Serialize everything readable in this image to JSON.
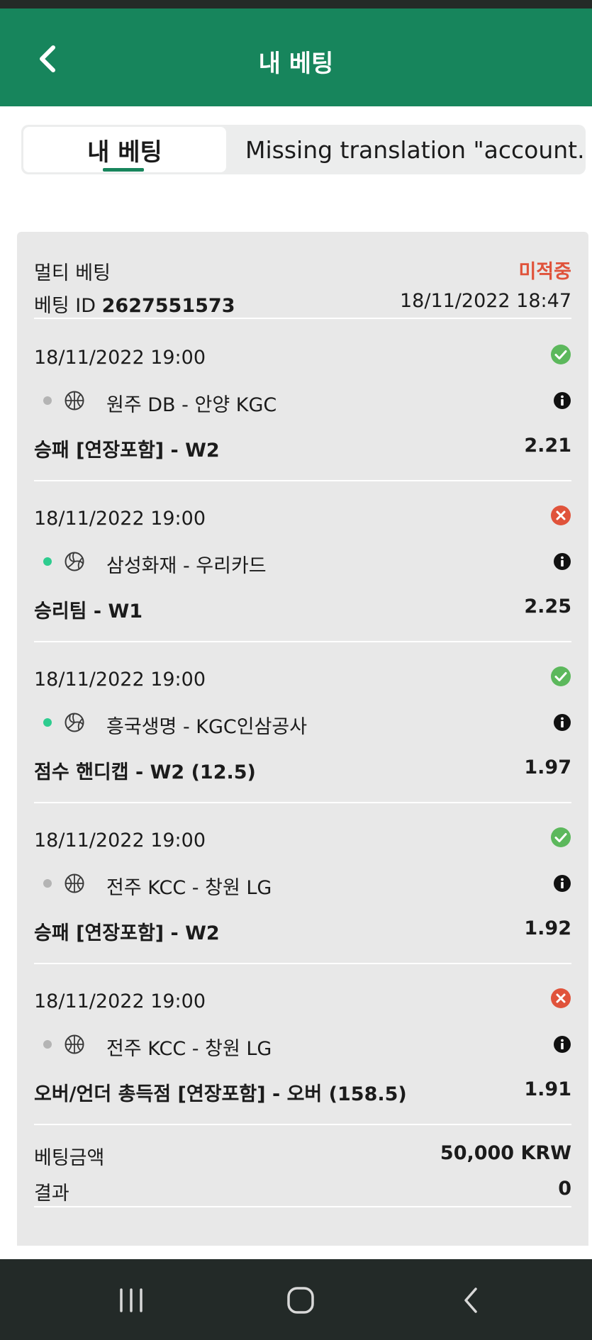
{
  "header": {
    "title": "내 베팅",
    "back_icon": "chevron-left-icon"
  },
  "tabs": [
    {
      "label": "내 베팅",
      "active": true
    },
    {
      "label": "Missing translation \"account.be",
      "active": false
    }
  ],
  "bet": {
    "type": "멀티 베팅",
    "status": "미적중",
    "id_label": "베팅 ID",
    "id_value": "2627551573",
    "datetime": "18/11/2022 18:47",
    "events": [
      {
        "date": "18/11/2022 19:00",
        "result": "won",
        "live_dot": false,
        "sport": "basketball-icon",
        "teams": "원주 DB - 안양 KGC",
        "market": "승패 [연장포함] - W2",
        "odds": "2.21"
      },
      {
        "date": "18/11/2022 19:00",
        "result": "lost",
        "live_dot": true,
        "sport": "volleyball-icon",
        "teams": "삼성화재 - 우리카드",
        "market": "승리팀 - W1",
        "odds": "2.25"
      },
      {
        "date": "18/11/2022 19:00",
        "result": "won",
        "live_dot": true,
        "sport": "volleyball-icon",
        "teams": "흥국생명 - KGC인삼공사",
        "market": "점수 핸디캡 - W2 (12.5)",
        "odds": "1.97"
      },
      {
        "date": "18/11/2022 19:00",
        "result": "won",
        "live_dot": false,
        "sport": "basketball-icon",
        "teams": "전주 KCC - 창원 LG",
        "market": "승패 [연장포함] - W2",
        "odds": "1.92"
      },
      {
        "date": "18/11/2022 19:00",
        "result": "lost",
        "live_dot": false,
        "sport": "basketball-icon",
        "teams": "전주 KCC - 창원 LG",
        "market": "오버/언더 총득점 [연장포함] - 오버 (158.5)",
        "odds": "1.91"
      }
    ],
    "stake_label": "베팅금액",
    "stake_value": "50,000 KRW",
    "result_label": "결과",
    "result_value": "0"
  },
  "colors": {
    "header_bg": "#17855c",
    "status_lost": "#e0533b",
    "won_icon": "#5cb85c",
    "lost_icon": "#e0533b",
    "live_dot": "#2ecc8f",
    "idle_dot": "#b4b4b4",
    "card_bg": "#e8e8e8",
    "nav_bg": "#232a28"
  },
  "nav": {
    "items": [
      "recent-apps-icon",
      "home-icon",
      "back-icon"
    ]
  }
}
